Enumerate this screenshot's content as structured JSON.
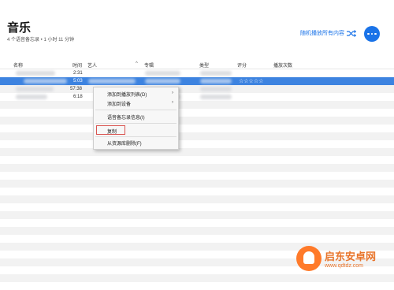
{
  "header": {
    "title": "音乐",
    "subtitle": "4 个语音备忘录 • 1 小时 11 分钟",
    "shuffle_label": "随机播放所有内容",
    "accent_color": "#1a73e8"
  },
  "table": {
    "columns": {
      "name": "名称",
      "time": "时间",
      "artist": "艺人",
      "album": "专辑",
      "genre": "类型",
      "rating": "评分",
      "plays": "播放次数"
    },
    "rows": [
      {
        "time": "2:31"
      },
      {
        "time": "5:03",
        "rating": "☆☆☆☆☆"
      },
      {
        "time": "57:38"
      },
      {
        "time": "6:18"
      }
    ],
    "selected_color": "#3d83e0"
  },
  "context_menu": {
    "items": [
      {
        "label": "添加到播放列表(D)",
        "has_submenu": true
      },
      {
        "label": "添加到设备",
        "has_submenu": true
      },
      {
        "label": "语音备忘录信息(I)"
      },
      {
        "label": "复制"
      },
      {
        "label": "从资源库删除(F)"
      }
    ],
    "submenu_arrow": "›"
  },
  "watermark": {
    "name": "启东安卓网",
    "url": "www.qdtdz.com"
  }
}
